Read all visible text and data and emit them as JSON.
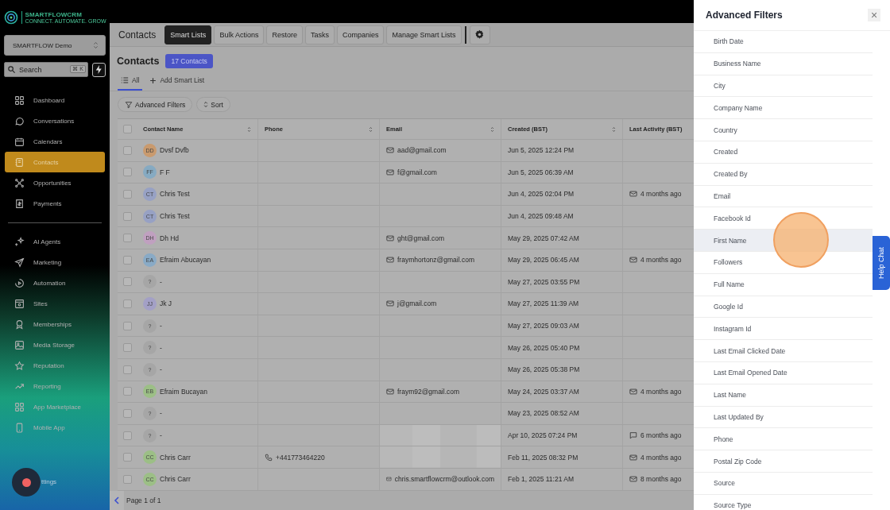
{
  "sidebar": {
    "logo_text": "SMARTFLOWCRM",
    "logo_tagline": "CONNECT. AUTOMATE. GROW",
    "account": "SMARTFLOW Demo",
    "search": {
      "placeholder": "Search",
      "shortcut": "⌘ K"
    },
    "items": [
      {
        "label": "Dashboard",
        "selected": false
      },
      {
        "label": "Conversations",
        "selected": false
      },
      {
        "label": "Calendars",
        "selected": false
      },
      {
        "label": "Contacts",
        "selected": true
      },
      {
        "label": "Opportunities",
        "selected": false
      },
      {
        "label": "Payments",
        "selected": false
      }
    ],
    "items2": [
      {
        "label": "AI Agents",
        "selected": false
      },
      {
        "label": "Marketing",
        "selected": false
      },
      {
        "label": "Automation",
        "selected": false
      },
      {
        "label": "Sites",
        "selected": false
      },
      {
        "label": "Memberships",
        "selected": false
      },
      {
        "label": "Media Storage",
        "selected": false
      },
      {
        "label": "Reputation",
        "selected": false
      },
      {
        "label": "Reporting",
        "selected": false
      },
      {
        "label": "App Marketplace",
        "selected": false
      },
      {
        "label": "Mobile App",
        "selected": false
      }
    ],
    "settings_label": "ttings"
  },
  "toolbar": {
    "title": "Contacts",
    "tabs": [
      {
        "label": "Smart Lists",
        "selected": true
      },
      {
        "label": "Bulk Actions",
        "selected": false
      },
      {
        "label": "Restore",
        "selected": false
      },
      {
        "label": "Tasks",
        "selected": false
      },
      {
        "label": "Companies",
        "selected": false
      },
      {
        "label": "Manage Smart Lists",
        "selected": false
      }
    ]
  },
  "heading": {
    "title": "Contacts",
    "count": "17 Contacts"
  },
  "list_tabs": [
    {
      "label": "All",
      "selected": true
    },
    {
      "label": "Add Smart List",
      "selected": false
    }
  ],
  "filter_buttons": [
    "Advanced Filters",
    "Sort"
  ],
  "table": {
    "select_all_checked": false,
    "columns": [
      "Contact Name",
      "Phone",
      "Email",
      "Created (BST)",
      "Last Activity (BST)"
    ],
    "rows": [
      {
        "checked": false,
        "initials": "DD",
        "color": "#c99a6e",
        "name": "Dvsf Dvfb",
        "email": "aad@gmail.com",
        "created": "Jun 5, 2025  12:24 PM"
      },
      {
        "checked": false,
        "initials": "FF",
        "color": "#86aac2",
        "name": "F F",
        "email": "f@gmail.com",
        "created": "Jun 5, 2025  06:39 AM"
      },
      {
        "checked": false,
        "initials": "CT",
        "color": "#97a1c4",
        "name": "Chris Test",
        "created": "Jun 4, 2025  02:04 PM",
        "activity": {
          "kind": "mail",
          "text": "4 months ago"
        }
      },
      {
        "checked": false,
        "initials": "CT",
        "color": "#97a1c4",
        "name": "Chris Test",
        "created": "Jun 4, 2025  09:48 AM"
      },
      {
        "checked": false,
        "initials": "DH",
        "color": "#c0a0c0",
        "name": "Dh Hd",
        "email": "ght@gmail.com",
        "created": "May 29, 2025  07:42 AM"
      },
      {
        "checked": false,
        "initials": "EA",
        "color": "#89aac6",
        "name": "Efraim Abucayan",
        "email": "fraymhortonz@gmail.com",
        "created": "May 29, 2025  06:45 AM",
        "activity": {
          "kind": "mail",
          "text": "4 months ago"
        }
      },
      {
        "checked": false,
        "initials": "?",
        "color": "#a6a6a6",
        "name": "-",
        "created": "May 27, 2025  03:55 PM"
      },
      {
        "checked": false,
        "initials": "JJ",
        "color": "#a3a0c6",
        "name": "Jk J",
        "email": "j@gmail.com",
        "created": "May 27, 2025  11:39 AM"
      },
      {
        "checked": false,
        "initials": "?",
        "color": "#a6a6a6",
        "name": "-",
        "created": "May 27, 2025  09:03 AM"
      },
      {
        "checked": false,
        "initials": "?",
        "color": "#a6a6a6",
        "name": "-",
        "created": "May 26, 2025  05:40 PM"
      },
      {
        "checked": false,
        "initials": "?",
        "color": "#a6a6a6",
        "name": "-",
        "created": "May 26, 2025  05:38 PM"
      },
      {
        "checked": false,
        "initials": "EB",
        "color": "#9cbf86",
        "name": "Efraim Bucayan",
        "email": "fraym92@gmail.com",
        "created": "May 24, 2025  03:37 AM",
        "activity": {
          "kind": "mail",
          "text": "4 months ago"
        }
      },
      {
        "checked": false,
        "initials": "?",
        "color": "#a6a6a6",
        "name": "-",
        "created": "May 23, 2025  08:52 AM"
      },
      {
        "checked": false,
        "initials": "?",
        "color": "#a6a6a6",
        "name": "-",
        "redacted": true,
        "created": "Apr 10, 2025  07:24 PM",
        "activity": {
          "kind": "chat",
          "text": "6 months ago"
        }
      },
      {
        "checked": false,
        "initials": "CC",
        "color": "#9cbf86",
        "name": "Chris Carr",
        "phone": "+441773464220",
        "redacted": true,
        "created": "Feb 11, 2025  08:32 PM",
        "activity": {
          "kind": "mail",
          "text": "4 months ago"
        }
      },
      {
        "checked": false,
        "initials": "CC",
        "color": "#9cbf86",
        "name": "Chris Carr",
        "email": "chris.smartflowcrm@outlook.com",
        "created": "Feb 1, 2025  11:21 AM",
        "activity": {
          "kind": "mail",
          "text": "8 months ago"
        }
      }
    ]
  },
  "pager": "Page 1 of 1",
  "panel": {
    "title": "Advanced Filters",
    "close": "×",
    "items": [
      {
        "label": "Birth Date",
        "hovered": false
      },
      {
        "label": "Business Name",
        "hovered": false
      },
      {
        "label": "City",
        "hovered": false
      },
      {
        "label": "Company Name",
        "hovered": false
      },
      {
        "label": "Country",
        "hovered": false
      },
      {
        "label": "Created",
        "hovered": false
      },
      {
        "label": "Created By",
        "hovered": false
      },
      {
        "label": "Email",
        "hovered": false
      },
      {
        "label": "Facebook Id",
        "hovered": false
      },
      {
        "label": "First Name",
        "hovered": true
      },
      {
        "label": "Followers",
        "hovered": false
      },
      {
        "label": "Full Name",
        "hovered": false
      },
      {
        "label": "Google Id",
        "hovered": false
      },
      {
        "label": "Instagram Id",
        "hovered": false
      },
      {
        "label": "Last Email Clicked Date",
        "hovered": false
      },
      {
        "label": "Last Email Opened Date",
        "hovered": false
      },
      {
        "label": "Last Name",
        "hovered": false
      },
      {
        "label": "Last Updated By",
        "hovered": false
      },
      {
        "label": "Phone",
        "hovered": false
      },
      {
        "label": "Postal Zip Code",
        "hovered": false
      },
      {
        "label": "Source",
        "hovered": false
      },
      {
        "label": "Source Type",
        "hovered": false
      }
    ]
  },
  "help_chat": "Help Chat"
}
